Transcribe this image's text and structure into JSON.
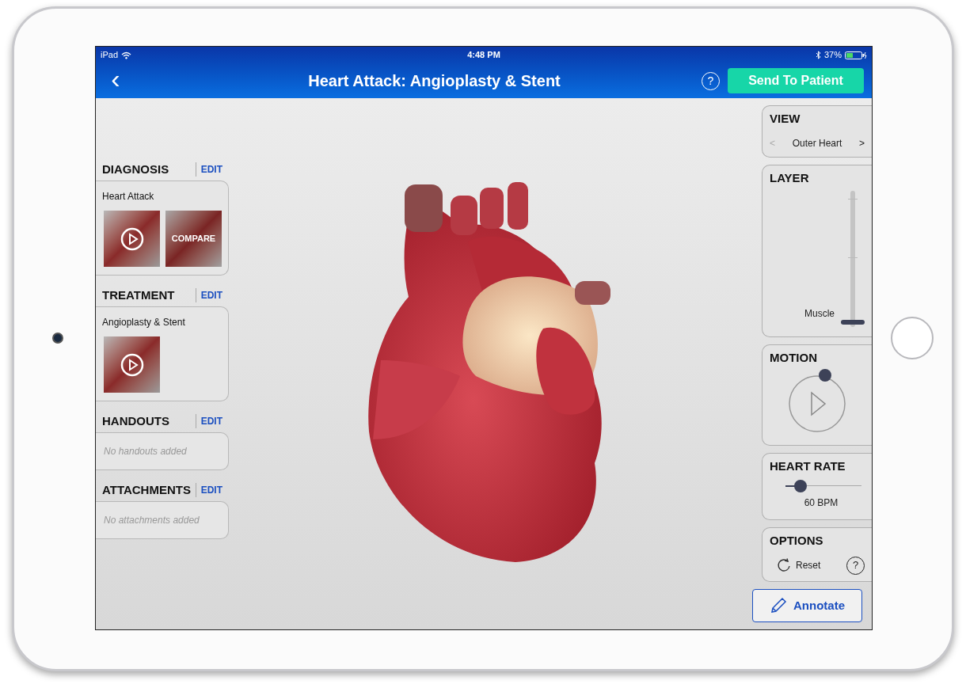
{
  "status_bar": {
    "device": "iPad",
    "time": "4:48 PM",
    "battery": "37%"
  },
  "nav_bar": {
    "back": "‹",
    "title": "Heart Attack: Angioplasty & Stent",
    "help": "?",
    "send_button": "Send To Patient"
  },
  "left_sections": [
    {
      "title": "DIAGNOSIS",
      "edit": "EDIT",
      "item": "Heart Attack",
      "thumbnails": [
        {
          "kind": "video"
        },
        {
          "kind": "compare",
          "label": "COMPARE"
        }
      ]
    },
    {
      "title": "TREATMENT",
      "edit": "EDIT",
      "item": "Angioplasty & Stent",
      "thumbnails": [
        {
          "kind": "video"
        }
      ]
    },
    {
      "title": "HANDOUTS",
      "edit": "EDIT",
      "empty": "No handouts added"
    },
    {
      "title": "ATTACHMENTS",
      "edit": "EDIT",
      "empty": "No attachments added"
    }
  ],
  "view": {
    "title": "VIEW",
    "prev": "<",
    "value": "Outer Heart",
    "next": ">"
  },
  "layer": {
    "title": "LAYER",
    "label": "Muscle",
    "level": 0
  },
  "motion": {
    "title": "MOTION"
  },
  "heart_rate": {
    "title": "HEART RATE",
    "level": 0.2,
    "reading": "60 BPM"
  },
  "options": {
    "title": "OPTIONS",
    "reset": "Reset",
    "help": "?"
  },
  "annotate_button": "Annotate"
}
